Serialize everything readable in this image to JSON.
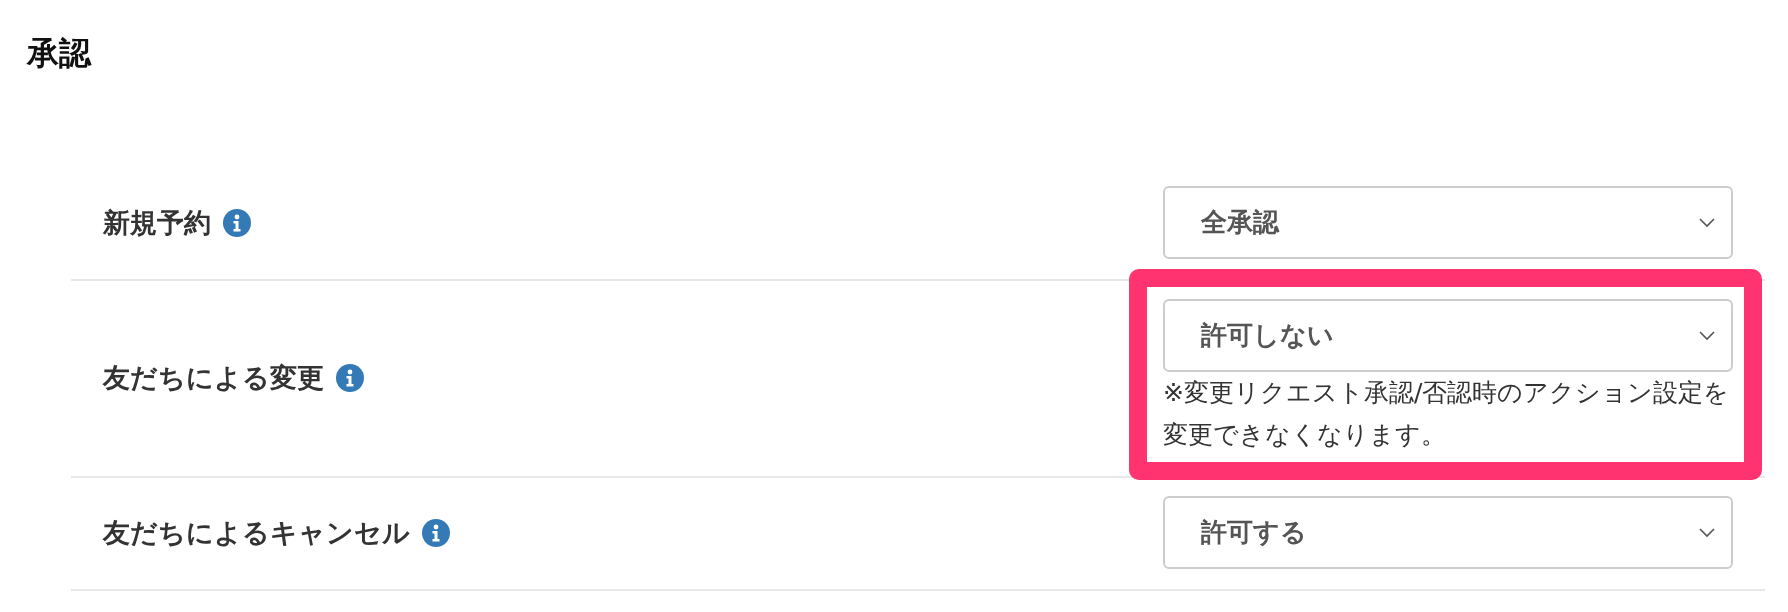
{
  "title": "承認",
  "rows": [
    {
      "label": "新規予約",
      "value": "全承認",
      "highlighted": false
    },
    {
      "label": "友だちによる変更",
      "value": "許可しない",
      "note": "※変更リクエスト承認/否認時のアクション設定を変更できなくなります。",
      "highlighted": true
    },
    {
      "label": "友だちによるキャンセル",
      "value": "許可する",
      "highlighted": false
    }
  ]
}
